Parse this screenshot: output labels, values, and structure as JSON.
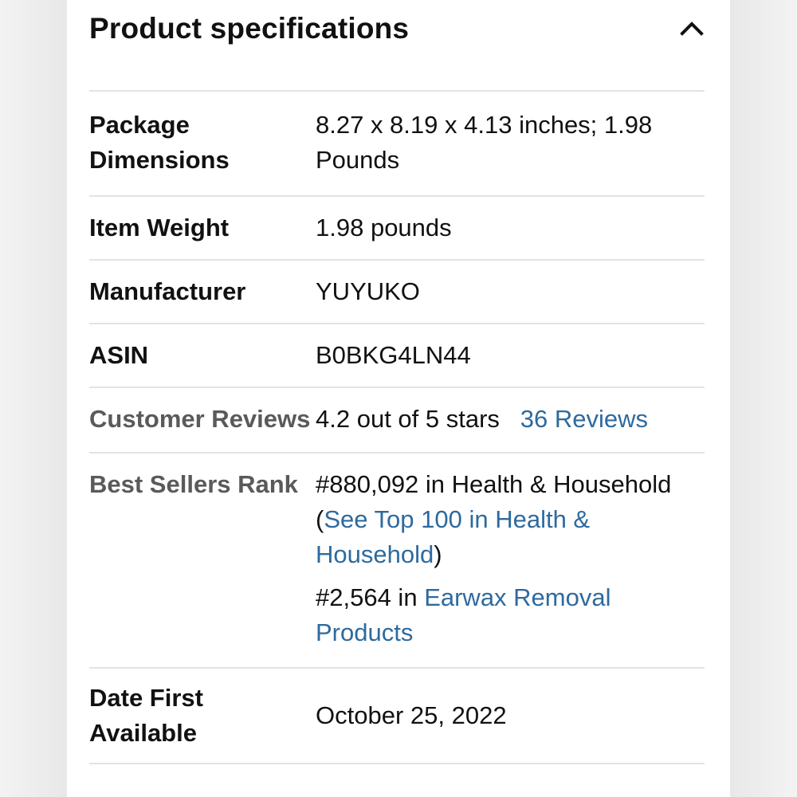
{
  "section": {
    "title": "Product specifications",
    "collapse_icon": "chevron-up-icon"
  },
  "specs": {
    "package_dimensions": {
      "label": "Package Dimensions",
      "value": "8.27 x 8.19 x 4.13 inches; 1.98 Pounds"
    },
    "item_weight": {
      "label": "Item Weight",
      "value": "1.98 pounds"
    },
    "manufacturer": {
      "label": "Manufacturer",
      "value": "YUYUKO"
    },
    "asin": {
      "label": "ASIN",
      "value": "B0BKG4LN44"
    },
    "customer_reviews": {
      "label": "Customer Reviews",
      "rating_text": "4.2 out of 5 stars",
      "reviews_link": "36 Reviews"
    },
    "best_sellers_rank": {
      "label": "Best Sellers Rank",
      "rank1_text": "#880,092 in Health & Household",
      "rank1_link": "See Top 100 in Health & Household",
      "rank2_text": "#2,564 in",
      "rank2_link": "Earwax Removal Products"
    },
    "date_first_available": {
      "label": "Date First Available",
      "value": "October 25, 2022"
    }
  },
  "colors": {
    "link": "#2e6a9e",
    "text": "#111111",
    "muted_label": "#5a5a5a",
    "divider": "#e3e3e3"
  }
}
